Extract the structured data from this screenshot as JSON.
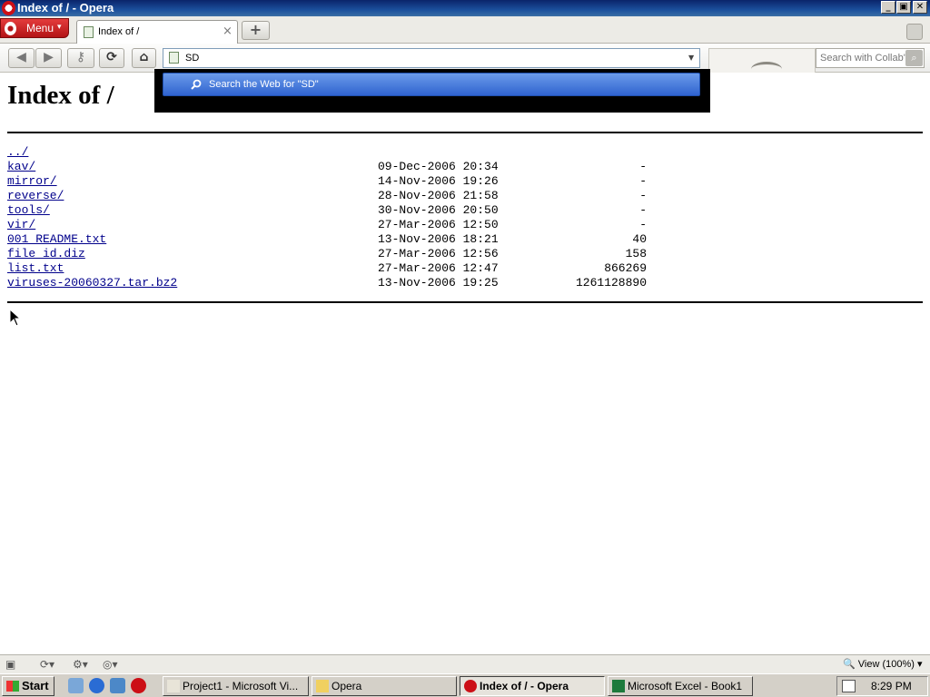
{
  "window": {
    "title": "Index of / - Opera",
    "controls": {
      "minimize": "_",
      "maximize": "▣",
      "close": "✕"
    }
  },
  "tabstrip": {
    "menu_label": "Menu",
    "tab_title": "Index of /",
    "tab_close": "×",
    "new_tab": "+"
  },
  "navbar": {
    "address_value": "SD",
    "search_placeholder": "Search with Collab'",
    "icons": [
      "back-icon",
      "forward-icon",
      "key-icon",
      "reload-icon",
      "home-icon",
      "page-icon",
      "search-icon"
    ]
  },
  "dropdown": {
    "suggestion": "Search the Web for \"SD\""
  },
  "page": {
    "title": "Index of /",
    "entries": [
      {
        "name": "../",
        "date": "",
        "size": ""
      },
      {
        "name": "kav/",
        "date": "09-Dec-2006 20:34",
        "size": "-"
      },
      {
        "name": "mirror/",
        "date": "14-Nov-2006 19:26",
        "size": "-"
      },
      {
        "name": "reverse/",
        "date": "28-Nov-2006 21:58",
        "size": "-"
      },
      {
        "name": "tools/",
        "date": "30-Nov-2006 20:50",
        "size": "-"
      },
      {
        "name": "vir/",
        "date": "27-Mar-2006 12:50",
        "size": "-"
      },
      {
        "name": "001_README.txt",
        "date": "13-Nov-2006 18:21",
        "size": "40"
      },
      {
        "name": "file_id.diz",
        "date": "27-Mar-2006 12:56",
        "size": "158"
      },
      {
        "name": "list.txt",
        "date": "27-Mar-2006 12:47",
        "size": "866269"
      },
      {
        "name": "viruses-20060327.tar.bz2",
        "date": "13-Nov-2006 19:25",
        "size": "1261128890"
      }
    ]
  },
  "statusbar": {
    "zoom": "View (100%)"
  },
  "taskbar": {
    "start_label": "Start",
    "tasks": [
      {
        "label": "Project1 - Microsoft Vi...",
        "active": false
      },
      {
        "label": "Opera",
        "active": false
      },
      {
        "label": "Index of / - Opera",
        "active": true
      },
      {
        "label": "Microsoft Excel - Book1",
        "active": false
      }
    ],
    "clock": "8:29 PM"
  },
  "colors": {
    "link": "#00008b",
    "titlebar": "#0a246a",
    "suggestion_highlight": "#2f63cf",
    "opera_red": "#cc0f16"
  }
}
